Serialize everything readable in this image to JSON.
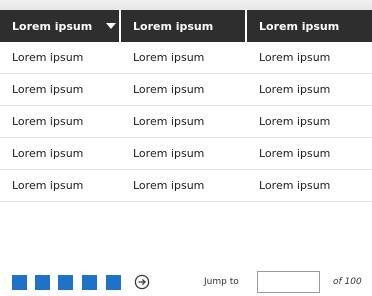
{
  "table": {
    "headers": [
      "Lorem ipsum",
      "Lorem ipsum",
      "Lorem ipsum"
    ],
    "sort_icon": "caret-down-icon",
    "rows": [
      [
        "Lorem ipsum",
        "Lorem ipsum",
        "Lorem ipsum"
      ],
      [
        "Lorem ipsum",
        "Lorem ipsum",
        "Lorem ipsum"
      ],
      [
        "Lorem ipsum",
        "Lorem ipsum",
        "Lorem ipsum"
      ],
      [
        "Lorem ipsum",
        "Lorem ipsum",
        "Lorem ipsum"
      ],
      [
        "Lorem ipsum",
        "Lorem ipsum",
        "Lorem ipsum"
      ]
    ]
  },
  "pagination": {
    "page_square_color": "#1e73c8",
    "next_icon": "circle-arrow-right-icon",
    "jump_label": "Jump to",
    "jump_value": "",
    "of_label": "of 100"
  },
  "colors": {
    "header_bg": "#2e2e2e",
    "header_text": "#ffffff"
  }
}
